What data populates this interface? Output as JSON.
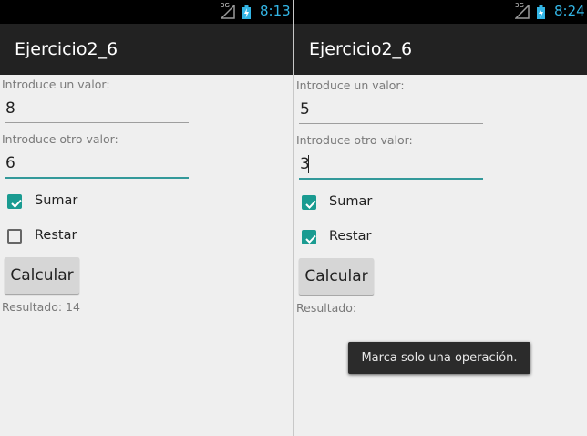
{
  "screens": [
    {
      "status": {
        "time": "8:13",
        "network": "3G"
      },
      "app_title": "Ejercicio2_6",
      "field1": {
        "label": "Introduce un valor:",
        "value": "8"
      },
      "field2": {
        "label": "Introduce otro valor:",
        "value": "6"
      },
      "checkbox_sum": {
        "label": "Sumar",
        "checked": true
      },
      "checkbox_sub": {
        "label": "Restar",
        "checked": false
      },
      "calc_button": "Calcular",
      "result": "Resultado: 14"
    },
    {
      "status": {
        "time": "8:24",
        "network": "3G"
      },
      "app_title": "Ejercicio2_6",
      "field1": {
        "label": "Introduce un valor:",
        "value": "5"
      },
      "field2": {
        "label": "Introduce otro valor:",
        "value": "3"
      },
      "checkbox_sum": {
        "label": "Sumar",
        "checked": true
      },
      "checkbox_sub": {
        "label": "Restar",
        "checked": true
      },
      "calc_button": "Calcular",
      "result": "Resultado:",
      "toast": "Marca solo una operación."
    }
  ],
  "colors": {
    "accent": "#1a9b91",
    "clock": "#33b5e5",
    "actionbar": "#222222",
    "background": "#efefef"
  }
}
